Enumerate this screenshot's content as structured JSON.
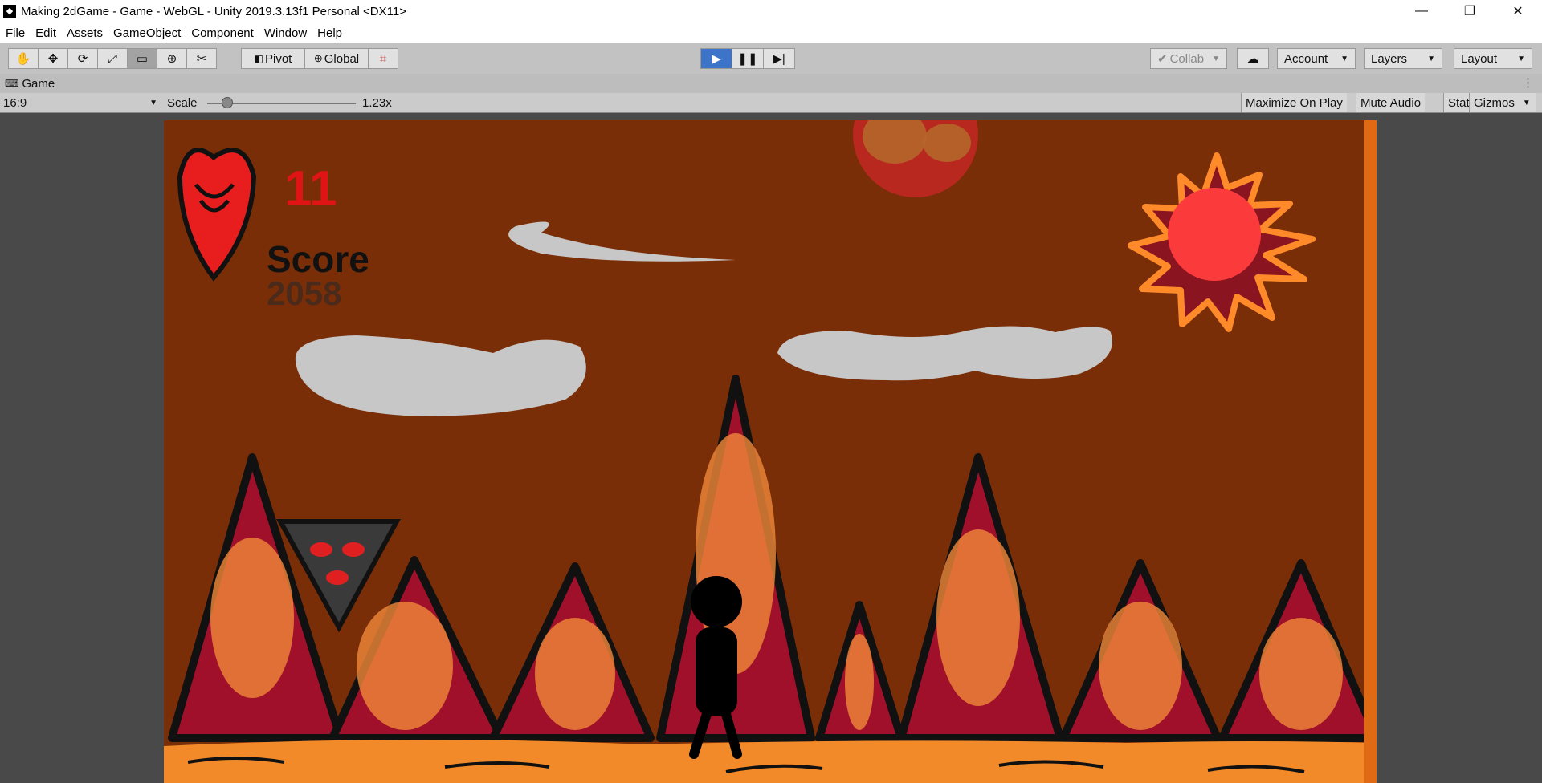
{
  "window": {
    "title": "Making 2dGame - Game - WebGL - Unity 2019.3.13f1 Personal <DX11>",
    "logo_icon": "unity-icon",
    "controls": [
      "minimize-icon",
      "restore-icon",
      "close-icon"
    ]
  },
  "menu": [
    "File",
    "Edit",
    "Assets",
    "GameObject",
    "Component",
    "Window",
    "Help"
  ],
  "toolbar": {
    "tools": [
      "hand-icon",
      "move-icon",
      "rotate-icon",
      "scale-icon",
      "rect-icon",
      "transform-icon",
      "custom-tool-icon"
    ],
    "pivot_label": "Pivot",
    "global_label": "Global",
    "collab_label": "Collab",
    "account_label": "Account",
    "layers_label": "Layers",
    "layout_label": "Layout"
  },
  "panel": {
    "tab_label": "Game",
    "aspect": "16:9",
    "scale_label": "Scale",
    "scale_value": "1.23x",
    "maximize_label": "Maximize On Play",
    "mute_label": "Mute Audio",
    "stats_label": "Stats",
    "gizmos_label": "Gizmos"
  },
  "game": {
    "lives": "11",
    "score_label": "Score",
    "score_value": "2058"
  },
  "colors": {
    "sky": "#7a2e08",
    "ground": "#f28a2a",
    "mountain": "#a0102a",
    "play_accent": "#3b74c9"
  }
}
